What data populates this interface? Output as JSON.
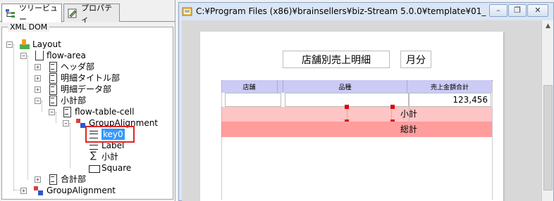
{
  "left_panel": {
    "tabs": [
      {
        "label": "ツリービュー",
        "active": true,
        "icon": "tree-view-icon"
      },
      {
        "label": "プロパティ",
        "active": false,
        "icon": "properties-icon"
      }
    ],
    "group_title": "XML DOM",
    "tree": [
      {
        "label": "Layout",
        "icon": "layout-icon",
        "expander": "-"
      },
      {
        "label": "flow-area",
        "icon": "flow-area-icon",
        "expander": "-"
      },
      {
        "label": "ヘッダ部",
        "icon": "section-icon",
        "expander": "+"
      },
      {
        "label": "明細タイトル部",
        "icon": "section-icon",
        "expander": "+"
      },
      {
        "label": "明細データ部",
        "icon": "section-icon",
        "expander": "+"
      },
      {
        "label": "小計部",
        "icon": "section-icon",
        "expander": "-"
      },
      {
        "label": "flow-table-cell",
        "icon": "section-icon",
        "expander": "-"
      },
      {
        "label": "GroupAlignment",
        "icon": "group-alignment-icon",
        "expander": "-"
      },
      {
        "label": "key0",
        "icon": "text-field-icon",
        "selected": true
      },
      {
        "label": "Label",
        "icon": "label-icon"
      },
      {
        "label": "小計",
        "icon": "sum-icon"
      },
      {
        "label": "Square",
        "icon": "square-icon"
      },
      {
        "label": "合計部",
        "icon": "section-icon",
        "expander": "+"
      },
      {
        "label": "GroupAlignment",
        "icon": "group-alignment-icon",
        "expander": "+"
      }
    ]
  },
  "document": {
    "title": "C:¥Program Files (x86)¥brainsellers¥biz-Stream 5.0.0¥template¥01_",
    "window_buttons": {
      "minimize": "–",
      "restore": "❐",
      "close": "✕"
    },
    "report": {
      "title": "店舗別売上明細",
      "month_label": "月分",
      "columns": [
        "店舗",
        "品種",
        "売上金額合計"
      ],
      "data_value": "123,456",
      "subtotal_label": "小計",
      "total_label": "総計"
    },
    "colors": {
      "header_band": "#cbcbf5",
      "subtotal_band": "#ffc4c4",
      "total_band": "#ff9c9c",
      "selection_box": "#e32424",
      "selection_highlight": "#3399ff"
    }
  }
}
